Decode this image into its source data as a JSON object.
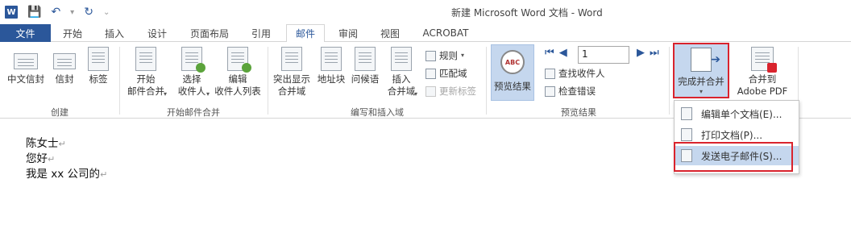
{
  "window": {
    "title": "新建 Microsoft Word 文档 - Word"
  },
  "quick_access": {
    "logo": "W",
    "icons": [
      "word-logo-icon",
      "save-icon",
      "undo-icon",
      "redo-icon",
      "customize-icon"
    ]
  },
  "tabs": {
    "file": "文件",
    "items": [
      "开始",
      "插入",
      "设计",
      "页面布局",
      "引用",
      "邮件",
      "审阅",
      "视图",
      "ACROBAT"
    ],
    "active": "邮件"
  },
  "ribbon": {
    "create": {
      "label": "创建",
      "buttons": [
        "中文信封",
        "信封",
        "标签"
      ]
    },
    "start_merge": {
      "label": "开始邮件合并",
      "start_line1": "开始",
      "start_line2": "邮件合并",
      "select_line1": "选择",
      "select_line2": "收件人",
      "edit_line1": "编辑",
      "edit_line2": "收件人列表"
    },
    "write_insert": {
      "label": "编写和插入域",
      "highlight_line1": "突出显示",
      "highlight_line2": "合并域",
      "address_block": "地址块",
      "greeting": "问候语",
      "insert_line1": "插入",
      "insert_line2": "合并域",
      "rules": "规则",
      "match_fields": "匹配域",
      "update_labels": "更新标签"
    },
    "preview": {
      "label": "预览结果",
      "preview_button": "预览结果",
      "record_number": "1",
      "find_recipient": "查找收件人",
      "check_errors": "检查错误"
    },
    "finish": {
      "finish_merge": "完成并合并",
      "merge_to_line1": "合并到",
      "merge_to_line2": "Adobe PDF"
    }
  },
  "finish_menu": {
    "items": [
      "编辑单个文档(E)...",
      "打印文档(P)...",
      "发送电子邮件(S)..."
    ]
  },
  "document": {
    "lines": [
      "陈女士",
      "您好",
      "我是 xx 公司的"
    ]
  },
  "colors": {
    "accent": "#2b579a",
    "highlight_red": "#d9232d",
    "hover_blue": "#c5d7ee"
  }
}
